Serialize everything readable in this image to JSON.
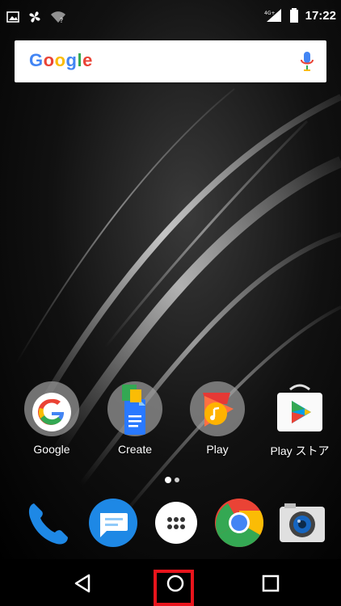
{
  "status_bar": {
    "time": "17:22",
    "network": "4G+",
    "icons": [
      "image-notification-icon",
      "fan-notification-icon",
      "wifi-unknown-icon",
      "signal-icon",
      "battery-icon"
    ]
  },
  "search": {
    "logo_text": "Google",
    "logo_colors": [
      "#4285F4",
      "#EA4335",
      "#FBBC05",
      "#4285F4",
      "#34A853",
      "#EA4335"
    ],
    "mic_icon": "mic-icon"
  },
  "apps": [
    {
      "label": "Google",
      "icon": "google-app-icon"
    },
    {
      "label": "Create",
      "icon": "docs-create-icon"
    },
    {
      "label": "Play",
      "icon": "play-music-icon"
    },
    {
      "label": "Play ストア",
      "icon": "play-store-icon"
    }
  ],
  "page_indicator": {
    "pages": 2,
    "current": 0
  },
  "dock": [
    {
      "name": "phone",
      "icon": "phone-icon"
    },
    {
      "name": "messages",
      "icon": "messages-icon"
    },
    {
      "name": "app-drawer",
      "icon": "app-drawer-icon"
    },
    {
      "name": "chrome",
      "icon": "chrome-icon"
    },
    {
      "name": "camera",
      "icon": "camera-icon"
    }
  ],
  "navigation": {
    "buttons": [
      "back",
      "home",
      "recents"
    ],
    "highlighted": "home",
    "highlight_color": "#e8141c"
  }
}
